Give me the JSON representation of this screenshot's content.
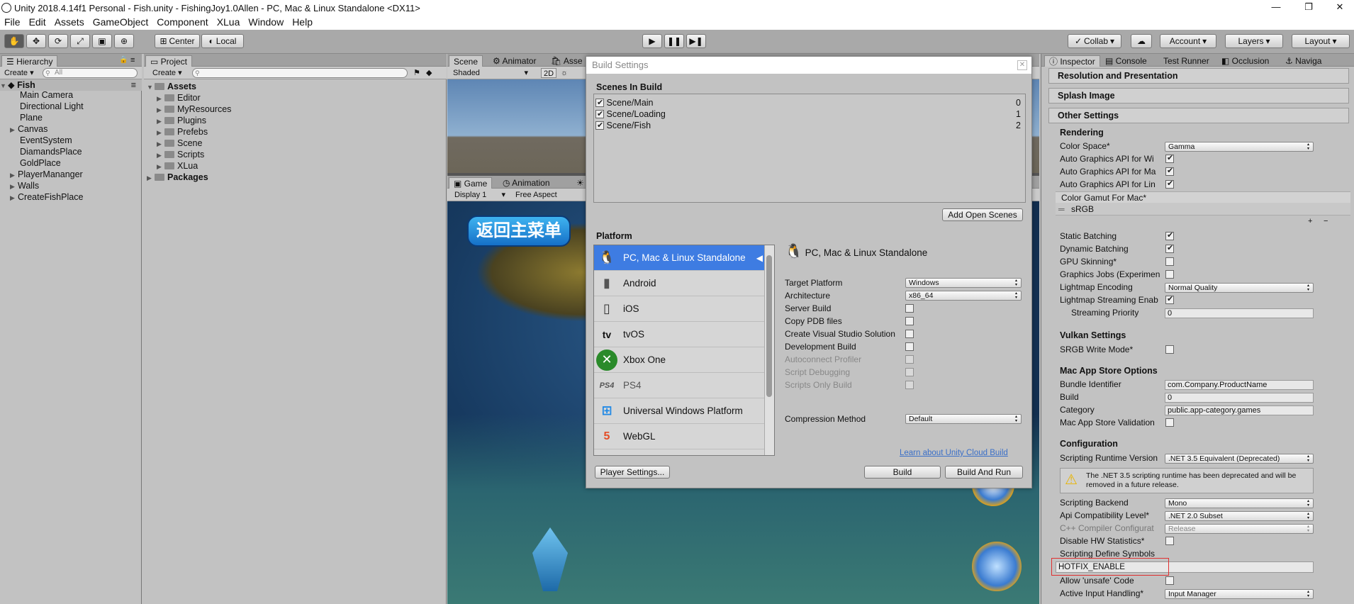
{
  "window": {
    "title": "Unity 2018.4.14f1 Personal - Fish.unity - FishingJoy1.0Allen - PC, Mac & Linux Standalone <DX11>"
  },
  "menu": [
    "File",
    "Edit",
    "Assets",
    "GameObject",
    "Component",
    "XLua",
    "Window",
    "Help"
  ],
  "toolbar": {
    "center": "Center",
    "local": "Local",
    "collab": "Collab",
    "account": "Account",
    "layers": "Layers",
    "layout": "Layout"
  },
  "hierarchy": {
    "tab": "Hierarchy",
    "create": "Create",
    "search_placeholder": "All",
    "scene": "Fish",
    "items": [
      "Main Camera",
      "Directional Light",
      "Plane",
      "Canvas",
      "EventSystem",
      "DiamandsPlace",
      "GoldPlace",
      "PlayerMananger",
      "Walls",
      "CreateFishPlace"
    ]
  },
  "project": {
    "tab": "Project",
    "create": "Create",
    "assets": "Assets",
    "folders": [
      "Editor",
      "MyResources",
      "Plugins",
      "Prefebs",
      "Scene",
      "Scripts",
      "XLua"
    ],
    "packages": "Packages"
  },
  "scene_view": {
    "tabs": [
      "Scene",
      "Animator",
      "Asse"
    ],
    "shading": "Shaded",
    "mode2d": "2D",
    "game_tabs": [
      "Game",
      "Animation",
      "Li"
    ],
    "display": "Display 1",
    "aspect": "Free Aspect",
    "game_button": "返回主菜单"
  },
  "build_settings": {
    "title": "Build Settings",
    "scenes_header": "Scenes In Build",
    "scenes": [
      {
        "name": "Scene/Main",
        "index": "0"
      },
      {
        "name": "Scene/Loading",
        "index": "1"
      },
      {
        "name": "Scene/Fish",
        "index": "2"
      }
    ],
    "add_open_scenes": "Add Open Scenes",
    "platform_header": "Platform",
    "platforms": [
      "PC, Mac & Linux Standalone",
      "Android",
      "iOS",
      "tvOS",
      "Xbox One",
      "PS4",
      "Universal Windows Platform",
      "WebGL"
    ],
    "selected_platform": "PC, Mac & Linux Standalone",
    "target_platform_label": "Target Platform",
    "target_platform": "Windows",
    "architecture_label": "Architecture",
    "architecture": "x86_64",
    "options": [
      {
        "label": "Server Build",
        "enabled": true
      },
      {
        "label": "Copy PDB files",
        "enabled": true
      },
      {
        "label": "Create Visual Studio Solution",
        "enabled": true
      },
      {
        "label": "Development Build",
        "enabled": true
      },
      {
        "label": "Autoconnect Profiler",
        "enabled": false
      },
      {
        "label": "Script Debugging",
        "enabled": false
      },
      {
        "label": "Scripts Only Build",
        "enabled": false
      }
    ],
    "compression_label": "Compression Method",
    "compression": "Default",
    "cloud_link": "Learn about Unity Cloud Build",
    "player_settings": "Player Settings...",
    "build": "Build",
    "build_and_run": "Build And Run"
  },
  "inspector": {
    "tabs": [
      "Inspector",
      "Console",
      "Test Runner",
      "Occlusion",
      "Naviga"
    ],
    "sections": [
      "Resolution and Presentation",
      "Splash Image",
      "Other Settings"
    ],
    "rendering": "Rendering",
    "color_space_label": "Color Space*",
    "color_space": "Gamma",
    "auto_api": [
      "Auto Graphics API  for Wi",
      "Auto Graphics API  for Ma",
      "Auto Graphics API  for Lin"
    ],
    "gamut_label": "Color Gamut For Mac*",
    "gamut_item": "sRGB",
    "static_batching": "Static Batching",
    "dynamic_batching": "Dynamic Batching",
    "gpu_skinning": "GPU Skinning*",
    "graphics_jobs": "Graphics Jobs (Experimen",
    "lightmap_encoding_label": "Lightmap Encoding",
    "lightmap_encoding": "Normal Quality",
    "lightmap_streaming": "Lightmap Streaming Enab",
    "streaming_priority_label": "Streaming Priority",
    "streaming_priority": "0",
    "vulkan": "Vulkan Settings",
    "srgb_write": "SRGB Write Mode*",
    "mac_store": "Mac App Store Options",
    "bundle_label": "Bundle Identifier",
    "bundle": "com.Company.ProductName",
    "build_label": "Build",
    "build": "0",
    "category_label": "Category",
    "category": "public.app-category.games",
    "mac_validation": "Mac App Store Validation",
    "configuration": "Configuration",
    "runtime_label": "Scripting Runtime Version",
    "runtime": ".NET 3.5 Equivalent (Deprecated)",
    "warning": "The .NET 3.5 scripting runtime has been deprecated and will be removed in a future release.",
    "backend_label": "Scripting Backend",
    "backend": "Mono",
    "api_level_label": "Api Compatibility Level*",
    "api_level": ".NET 2.0 Subset",
    "cpp_label": "C++ Compiler Configurat",
    "cpp": "Release",
    "disable_hw": "Disable HW Statistics*",
    "define_label": "Scripting Define Symbols",
    "define": "HOTFIX_ENABLE",
    "unsafe": "Allow 'unsafe' Code",
    "input_label": "Active Input Handling*",
    "input": "Input Manager"
  },
  "colors": {
    "selection": "#3e7ce2",
    "highlight": "#e03030"
  }
}
